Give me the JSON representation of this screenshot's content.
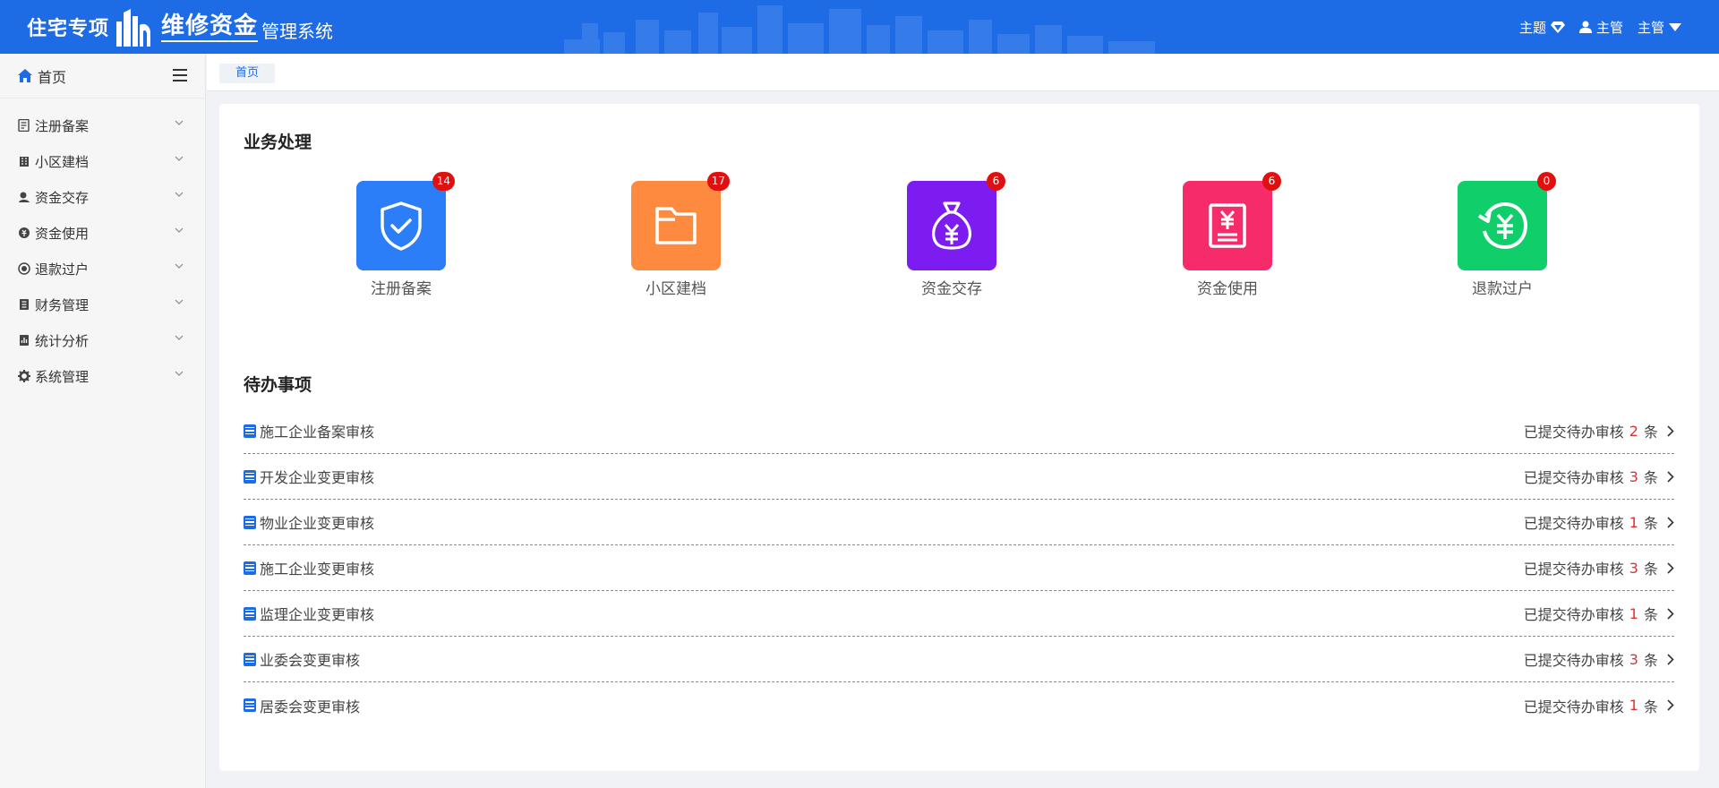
{
  "header": {
    "logo": {
      "part1": "住宅专项",
      "part2": "维修资金",
      "part3": "管理系统"
    },
    "theme_label": "主题",
    "user_name": "主管",
    "user_menu_label": "主管"
  },
  "sidebar": {
    "home_label": "首页",
    "items": [
      {
        "label": "注册备案",
        "icon": "register-icon"
      },
      {
        "label": "小区建档",
        "icon": "building-icon"
      },
      {
        "label": "资金交存",
        "icon": "deposit-icon"
      },
      {
        "label": "资金使用",
        "icon": "usage-icon"
      },
      {
        "label": "退款过户",
        "icon": "refund-icon"
      },
      {
        "label": "财务管理",
        "icon": "finance-icon"
      },
      {
        "label": "统计分析",
        "icon": "stats-icon"
      },
      {
        "label": "系统管理",
        "icon": "gear-icon"
      }
    ]
  },
  "breadcrumb": {
    "current": "首页"
  },
  "business": {
    "title": "业务处理",
    "tiles": [
      {
        "label": "注册备案",
        "count": "14",
        "color": "#2c7ef8",
        "icon": "shield-check-icon"
      },
      {
        "label": "小区建档",
        "count": "17",
        "color": "#fd8a3e",
        "icon": "folder-icon"
      },
      {
        "label": "资金交存",
        "count": "6",
        "color": "#7d1cf0",
        "icon": "money-bag-icon"
      },
      {
        "label": "资金使用",
        "count": "6",
        "color": "#f62c6a",
        "icon": "yuan-document-icon"
      },
      {
        "label": "退款过户",
        "count": "0",
        "color": "#10cf6b",
        "icon": "refund-cycle-icon"
      }
    ]
  },
  "todo": {
    "title": "待办事项",
    "prefix": "已提交待办审核",
    "suffix": "条",
    "items": [
      {
        "name": "施工企业备案审核",
        "count": "2"
      },
      {
        "name": "开发企业变更审核",
        "count": "3"
      },
      {
        "name": "物业企业变更审核",
        "count": "1"
      },
      {
        "name": "施工企业变更审核",
        "count": "3"
      },
      {
        "name": "监理企业变更审核",
        "count": "1"
      },
      {
        "name": "业委会变更审核",
        "count": "3"
      },
      {
        "name": "居委会变更审核",
        "count": "1"
      }
    ]
  },
  "colors": {
    "primary": "#1e6be6",
    "badge": "#e01010",
    "count": "#e03030"
  }
}
